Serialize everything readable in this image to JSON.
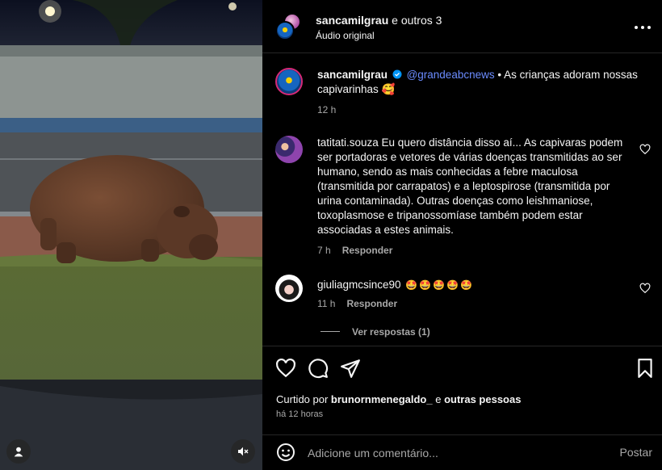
{
  "header": {
    "names_user": "sancamilgrau",
    "names_rest": " e outros 3",
    "subtitle": "Áudio original"
  },
  "caption": {
    "user": "sancamilgrau",
    "mention": "@grandeabcnews",
    "text": " • As crianças adoram nossas capivarinhas 🥰",
    "time": "12 h"
  },
  "comments": [
    {
      "user": "tatitati.souza",
      "text": " Eu quero distância disso aí... As capivaras podem ser portadoras e vetores de várias doenças transmitidas ao ser humano, sendo as mais conhecidas a febre maculosa (transmitida por carrapatos) e a leptospirose (transmitida por urina contaminada). Outras doenças como leishmaniose, toxoplasmose e tripanossomíase também podem estar associadas a estes animais.",
      "time": "7 h",
      "reply": "Responder"
    },
    {
      "user": "giuliagmcsince90",
      "text": " 🤩🤩🤩🤩🤩",
      "time": "11 h",
      "reply": "Responder",
      "view_replies": "Ver respostas (1)"
    }
  ],
  "likes": {
    "prefix": "Curtido por ",
    "user": "brunornmenegaldo_",
    "middle": " e ",
    "rest": "outras pessoas",
    "when": "há 12 horas"
  },
  "composer": {
    "placeholder": "Adicione um comentário...",
    "post_label": "Postar"
  },
  "icons": {
    "more": "more-options-icon",
    "like": "heart-icon",
    "comment": "comment-icon",
    "share": "share-icon",
    "save": "bookmark-icon",
    "emoji": "emoji-icon",
    "mute": "muted-speaker-icon",
    "user": "user-icon"
  },
  "colors": {
    "mention": "#6b8cff",
    "secondary_text": "#a8a8a8",
    "background": "#000000"
  }
}
